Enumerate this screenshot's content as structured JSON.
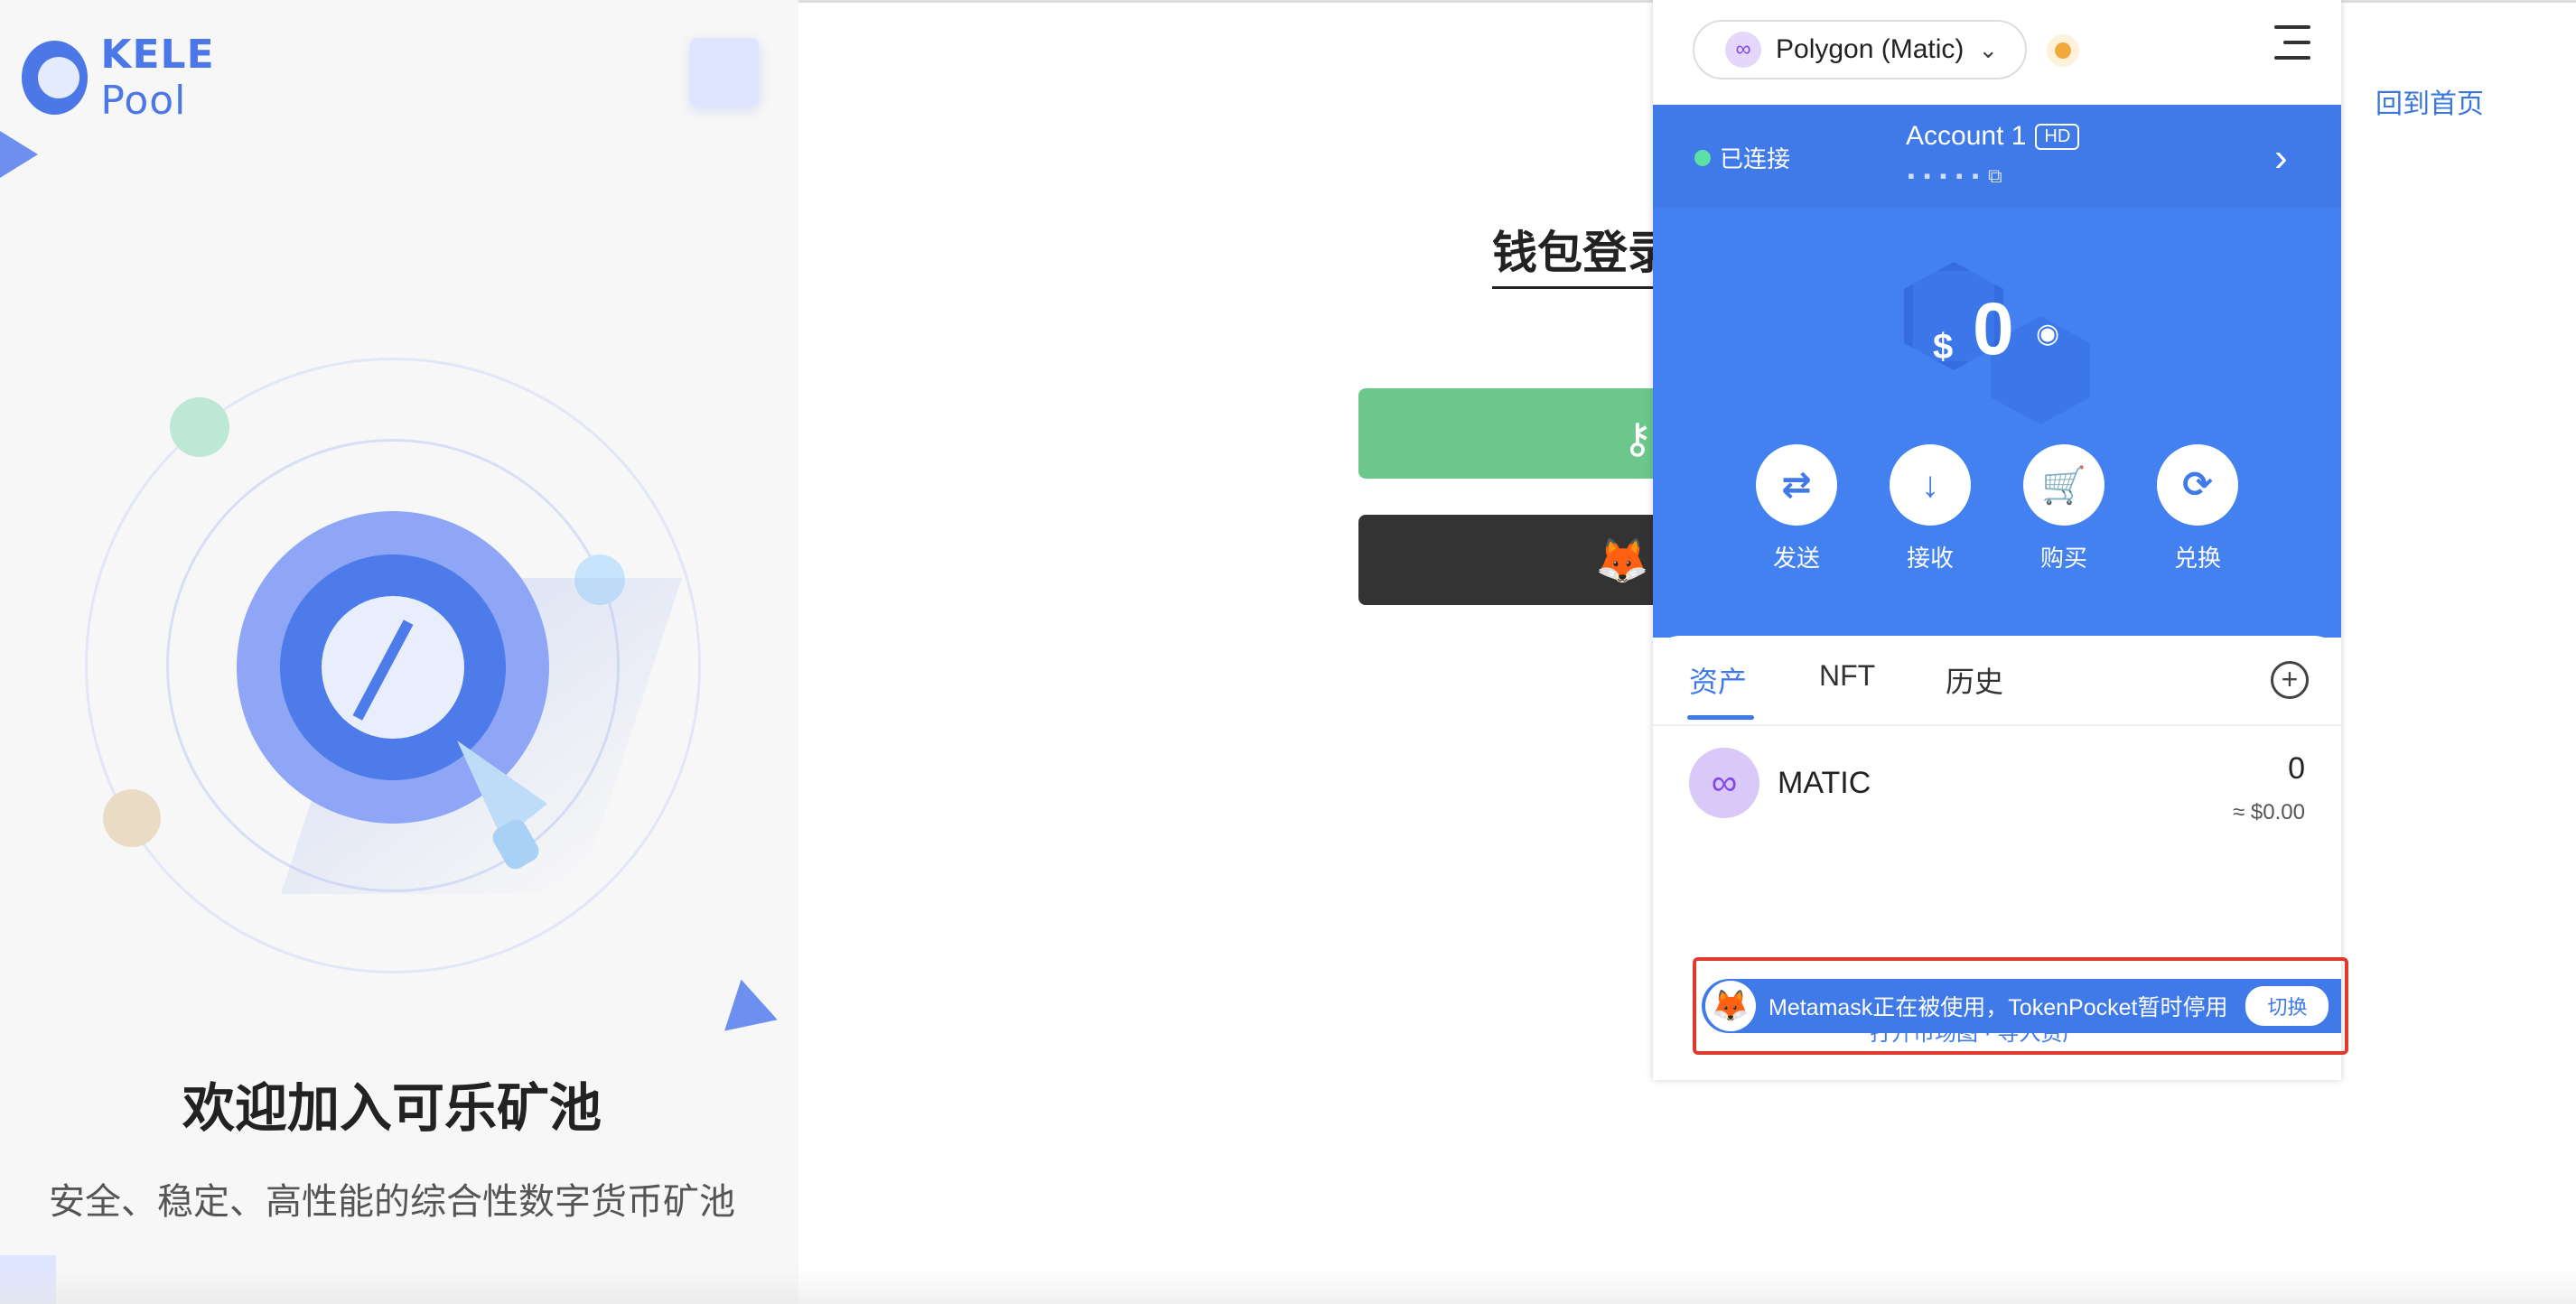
{
  "brand": {
    "logo_text": "KELE",
    "logo_text_pool": "Pool"
  },
  "left": {
    "welcome": "欢迎加入可乐矿池",
    "subtitle": "安全、稳定、高性能的综合性数字货币矿池"
  },
  "main": {
    "login_title": "钱包登录",
    "back_home": "回到首页",
    "green_button_icon": "key-icon",
    "dark_button_icon": "metamask-fox-icon"
  },
  "wallet": {
    "network": "Polygon (Matic)",
    "connected": "已连接",
    "account_name": "Account 1",
    "account_badge": "HD",
    "balance_currency": "$",
    "balance_value": "0",
    "actions": {
      "send": "发送",
      "receive": "接收",
      "buy": "购买",
      "swap": "兑换"
    },
    "tabs": {
      "assets": "资产",
      "nft": "NFT",
      "history": "历史"
    },
    "token": {
      "name": "MATIC",
      "balance": "0",
      "usd": "≈ $0.00"
    },
    "hidden_link": "打开市场图 · 导入资产"
  },
  "notice": {
    "text": "Metamask正在被使用，TokenPocket暂时停用",
    "button": "切换"
  },
  "colors": {
    "accent": "#4381f0",
    "green": "#6cc78d",
    "dark": "#333333",
    "highlight": "#e03a2e"
  }
}
